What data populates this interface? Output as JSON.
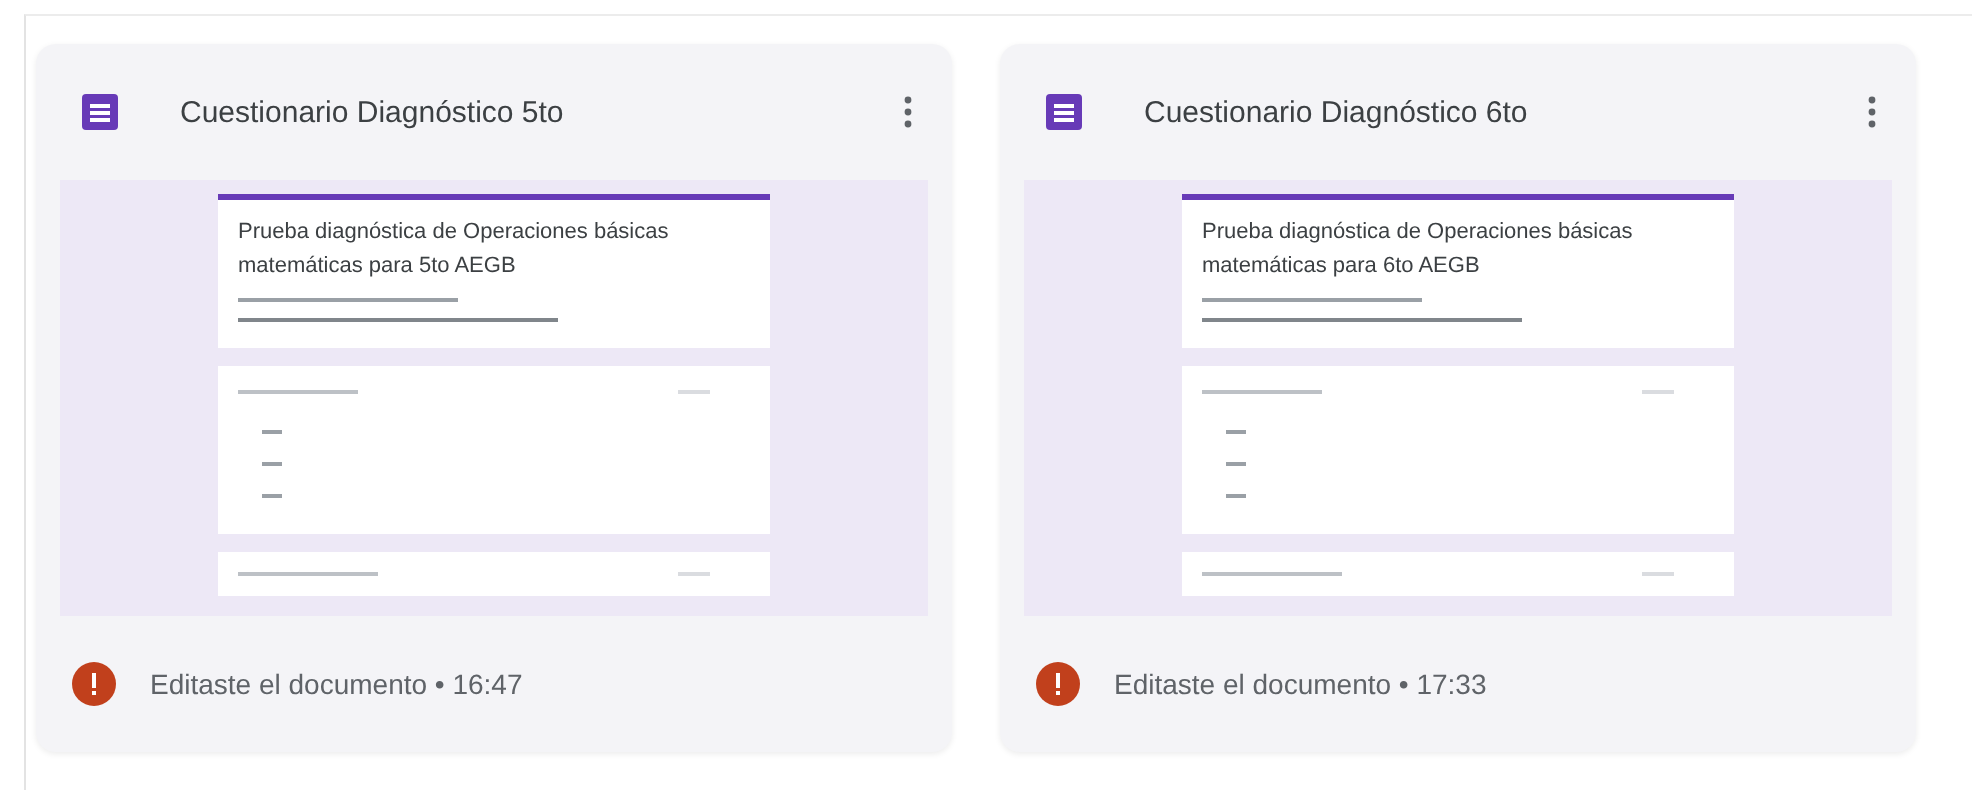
{
  "cards": [
    {
      "title": "Cuestionario Diagnóstico 5to",
      "preview_title": "Prueba diagnóstica de Operaciones básicas matemáticas para 5to AEGB",
      "activity": "Editaste el documento • 16:47"
    },
    {
      "title": "Cuestionario Diagnóstico 6to",
      "preview_title": "Prueba diagnóstica de Operaciones básicas matemáticas para 6to AEGB",
      "activity": "Editaste el documento • 17:33"
    }
  ]
}
